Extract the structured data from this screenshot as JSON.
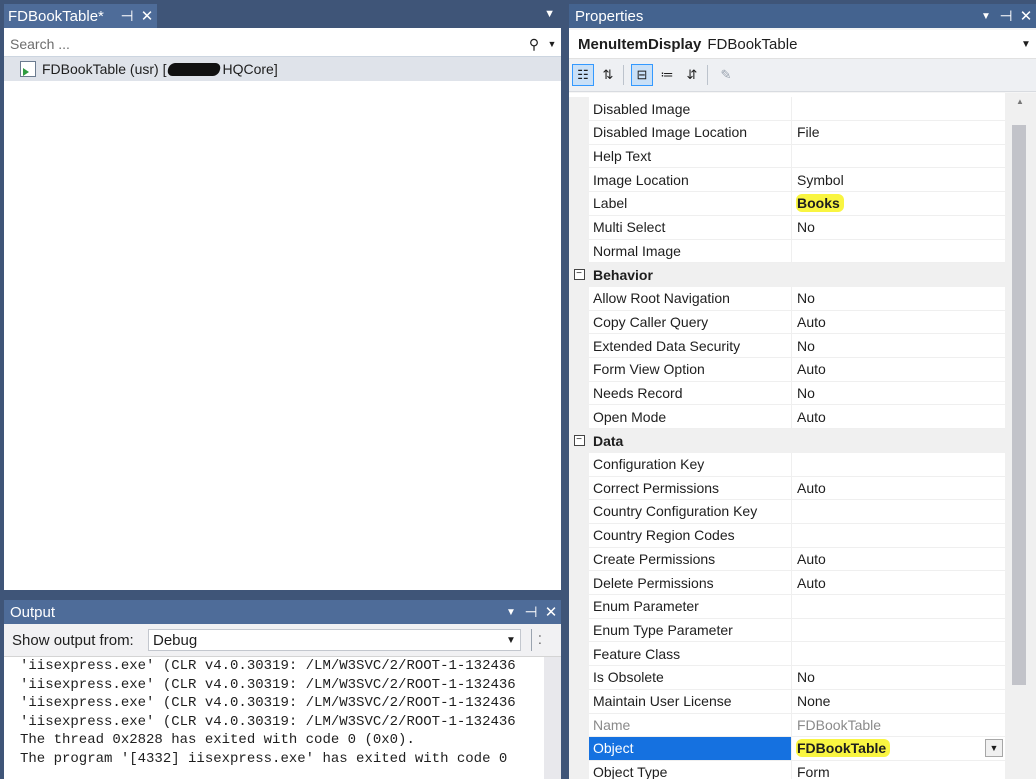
{
  "solution": {
    "tab_title": "FDBookTable*",
    "search_placeholder": "Search ...",
    "item_prefix": "FDBookTable (usr) [",
    "item_suffix": "HQCore]"
  },
  "output": {
    "title": "Output",
    "show_from_label": "Show output from:",
    "source": "Debug",
    "lines": [
      "'iisexpress.exe' (CLR v4.0.30319: /LM/W3SVC/2/ROOT-1-132436",
      "'iisexpress.exe' (CLR v4.0.30319: /LM/W3SVC/2/ROOT-1-132436",
      "'iisexpress.exe' (CLR v4.0.30319: /LM/W3SVC/2/ROOT-1-132436",
      "'iisexpress.exe' (CLR v4.0.30319: /LM/W3SVC/2/ROOT-1-132436",
      "The thread 0x2828 has exited with code 0 (0x0).",
      "The program '[4332] iisexpress.exe' has exited with code 0"
    ]
  },
  "properties": {
    "title": "Properties",
    "object_type": "MenuItemDisplay",
    "object_name": "FDBookTable",
    "rows": [
      {
        "name": "Disabled Image",
        "value": ""
      },
      {
        "name": "Disabled Image Location",
        "value": "File"
      },
      {
        "name": "Help Text",
        "value": ""
      },
      {
        "name": "Image Location",
        "value": "Symbol"
      },
      {
        "name": "Label",
        "value": "Books",
        "highlight": true
      },
      {
        "name": "Multi Select",
        "value": "No"
      },
      {
        "name": "Normal Image",
        "value": ""
      },
      {
        "category": "Behavior"
      },
      {
        "name": "Allow Root Navigation",
        "value": "No"
      },
      {
        "name": "Copy Caller Query",
        "value": "Auto"
      },
      {
        "name": "Extended Data Security",
        "value": "No"
      },
      {
        "name": "Form View Option",
        "value": "Auto"
      },
      {
        "name": "Needs Record",
        "value": "No"
      },
      {
        "name": "Open Mode",
        "value": "Auto"
      },
      {
        "category": "Data"
      },
      {
        "name": "Configuration Key",
        "value": ""
      },
      {
        "name": "Correct Permissions",
        "value": "Auto"
      },
      {
        "name": "Country Configuration Key",
        "value": ""
      },
      {
        "name": "Country Region Codes",
        "value": ""
      },
      {
        "name": "Create Permissions",
        "value": "Auto"
      },
      {
        "name": "Delete Permissions",
        "value": "Auto"
      },
      {
        "name": "Enum Parameter",
        "value": ""
      },
      {
        "name": "Enum Type Parameter",
        "value": ""
      },
      {
        "name": "Feature Class",
        "value": ""
      },
      {
        "name": "Is Obsolete",
        "value": "No"
      },
      {
        "name": "Maintain User License",
        "value": "None"
      },
      {
        "name": "Name",
        "value": "FDBookTable",
        "disabled": true
      },
      {
        "name": "Object",
        "value": "FDBookTable",
        "highlight": true,
        "selected": true,
        "dropdown": true
      },
      {
        "name": "Object Type",
        "value": "Form"
      }
    ]
  },
  "colors": {
    "accent": "#1571e0",
    "highlight": "#f9f541",
    "title_bar": "#44638f"
  }
}
